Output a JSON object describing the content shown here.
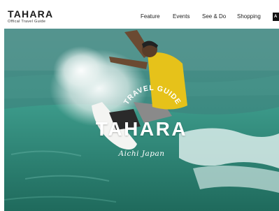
{
  "brand": {
    "title": "TAHARA",
    "subtitle": "Offical Travel Guide"
  },
  "nav": {
    "items": [
      "Feature",
      "Events",
      "See & Do",
      "Shopping"
    ],
    "language_chip": "A"
  },
  "hero": {
    "arc_text": "TRAVEL GUIDE",
    "title": "TAHARA",
    "place": "Aichi Japan"
  },
  "colors": {
    "header_bg": "#ffffff",
    "text_dark": "#1a1a1a",
    "hero_text": "#ffffff",
    "sea": "#2f7f74",
    "surfer_shirt": "#e6c21a"
  }
}
